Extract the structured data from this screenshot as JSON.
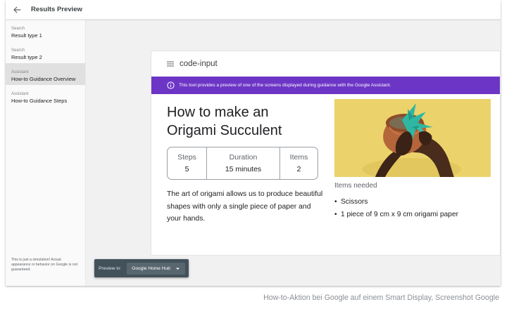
{
  "header": {
    "title": "Results Preview",
    "back_icon": "arrow-left-icon"
  },
  "sidebar": {
    "items": [
      {
        "category": "Search",
        "label": "Result type 1",
        "active": false
      },
      {
        "category": "Search",
        "label": "Result type 2",
        "active": false
      },
      {
        "category": "Assistant",
        "label": "How-to Guidance Overview",
        "active": true
      },
      {
        "category": "Assistant",
        "label": "How-to Guidance Steps",
        "active": false
      }
    ],
    "note": "This is just a simulation! Actual appearance or behavior on Google is not guaranteed."
  },
  "card": {
    "header_icon": "menu-icon",
    "header_title": "code-input",
    "banner": {
      "icon": "info-icon",
      "text": "This tool provides a preview of one of the screens displayed during guidance with the Google Assistant.",
      "color": "#6d35c6"
    },
    "title": "How to make an Origami Succulent",
    "stats": [
      {
        "label": "Steps",
        "value": "5"
      },
      {
        "label": "Duration",
        "value": "15 minutes"
      },
      {
        "label": "Items",
        "value": "2"
      }
    ],
    "description": "The art of origami allows us to produce beautiful shapes with only a single piece of paper and your hands.",
    "items_needed_label": "Items needed",
    "items_needed": [
      "Scissors",
      "1 piece of 9 cm x 9 cm origami paper"
    ]
  },
  "preview": {
    "label": "Preview in:",
    "selected": "Google Home Hub",
    "icon": "caret-down-icon"
  },
  "caption": "How-to-Aktion bei Google auf einem Smart Display, Screenshot Google",
  "colors": {
    "accent": "#6d35c6",
    "preview_bar": "#42515a",
    "photo_background": "#ecd26b"
  }
}
